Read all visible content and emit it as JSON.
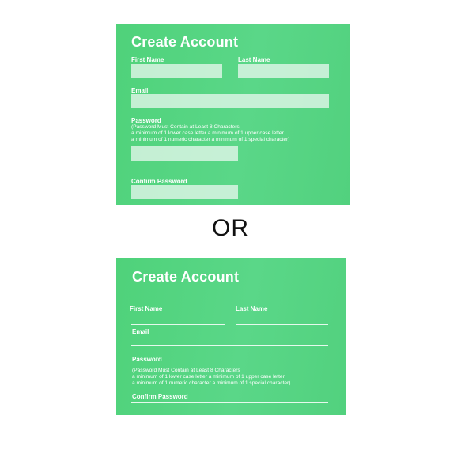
{
  "form": {
    "title": "Create Account",
    "first_name_label": "First Name",
    "last_name_label": "Last Name",
    "email_label": "Email",
    "password_label": "Password",
    "password_rules": [
      "(Password Must Contain at Least 8 Characters",
      "a minimum of 1 lower case letter  a minimum of 1 upper case letter",
      "a minimum of 1 numeric character  a minimum of 1 special character)"
    ],
    "confirm_password_label": "Confirm Password"
  },
  "separator": "OR",
  "colors": {
    "card_green": "#55d580",
    "field_fill": "#e8f7ee",
    "text": "#ffffff"
  }
}
